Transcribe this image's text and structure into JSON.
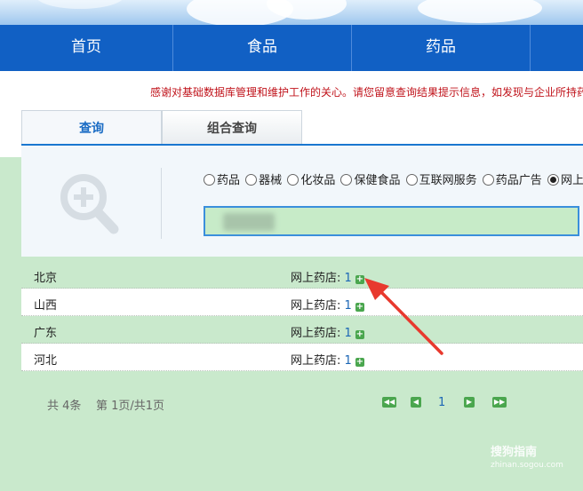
{
  "nav": {
    "items": [
      "首页",
      "食品",
      "药品"
    ]
  },
  "notice": "感谢对基础数据库管理和维护工作的关心。请您留意查询结果提示信息，如发现与企业所持药",
  "tabs": {
    "active": "查询",
    "other": "组合查询"
  },
  "types": [
    {
      "label": "药品",
      "checked": false
    },
    {
      "label": "器械",
      "checked": false
    },
    {
      "label": "化妆品",
      "checked": false
    },
    {
      "label": "保健食品",
      "checked": false
    },
    {
      "label": "互联网服务",
      "checked": false
    },
    {
      "label": "药品广告",
      "checked": false
    },
    {
      "label": "网上药店",
      "checked": true
    }
  ],
  "results": [
    {
      "province": "北京",
      "label": "网上药店:",
      "count": "1"
    },
    {
      "province": "山西",
      "label": "网上药店:",
      "count": "1"
    },
    {
      "province": "广东",
      "label": "网上药店:",
      "count": "1"
    },
    {
      "province": "河北",
      "label": "网上药店:",
      "count": "1"
    }
  ],
  "pager": {
    "total": "共 4条",
    "page": "第 1页/共1页",
    "current": "1"
  },
  "watermark": {
    "brand": "搜狗指南",
    "site": "zhinan.sogou.com"
  },
  "colors": {
    "nav": "#1160c4",
    "accent": "#1a77d0",
    "notice": "#c0131b",
    "plus": "#4aa64e",
    "arrow": "#e8392e"
  }
}
